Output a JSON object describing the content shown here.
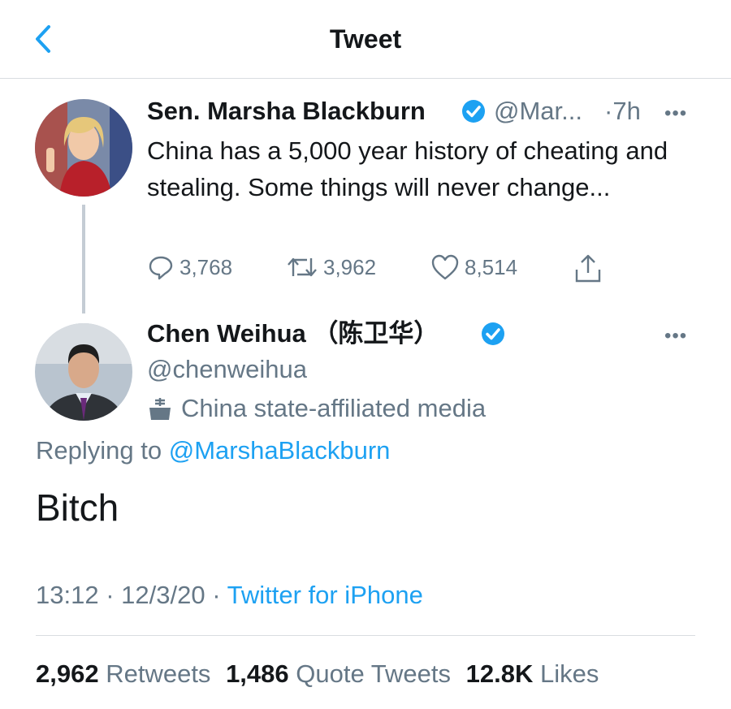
{
  "header": {
    "title": "Tweet"
  },
  "icons": {
    "back": "chevron-left-icon",
    "verified": "verified-badge-icon",
    "reply": "reply-icon",
    "retweet": "retweet-icon",
    "like": "heart-icon",
    "share": "share-icon",
    "more": "more-dots-icon",
    "media": "state-media-icon"
  },
  "colors": {
    "accent": "#1da1f2",
    "secondary_text": "#657786",
    "divider": "#d9dde1"
  },
  "parent_tweet": {
    "name": "Sen. Marsha Blackburn",
    "handle": "@Mar...",
    "time": "·7h",
    "text": "China has a 5,000 year history of cheating and stealing. Some things will never change...",
    "replies": "3,768",
    "retweets": "3,962",
    "likes": "8,514"
  },
  "reply_tweet": {
    "name": "Chen Weihua （陈卫华）",
    "handle": "@chenweihua",
    "label": "China state-affiliated media",
    "replying_prefix": "Replying to",
    "replying_to": "@MarshaBlackburn",
    "text": "Bitch",
    "time": "13:12",
    "date": "12/3/20",
    "source": "Twitter for iPhone",
    "sep1": "·",
    "sep2": "·"
  },
  "stats": {
    "retweets_count": "2,962",
    "retweets_label": "Retweets",
    "quotes_count": "1,486",
    "quotes_label": "Quote Tweets",
    "likes_count": "12.8K",
    "likes_label": "Likes"
  }
}
